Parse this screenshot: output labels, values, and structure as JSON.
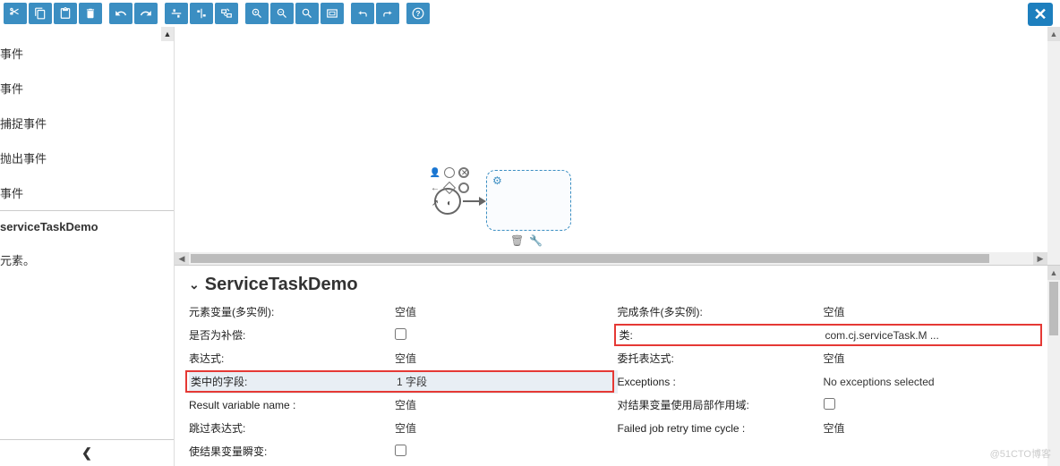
{
  "toolbar": {
    "groups": [
      [
        "cut",
        "copy",
        "paste",
        "delete"
      ],
      [
        "undo",
        "redo"
      ],
      [
        "align-h",
        "align-v",
        "same-size"
      ],
      [
        "zoom-in",
        "zoom-out",
        "zoom-fit",
        "zoom-actual"
      ],
      [
        "bend-left",
        "bend-right"
      ],
      [
        "help"
      ]
    ]
  },
  "sidebar": {
    "items": [
      {
        "label": "事件"
      },
      {
        "label": "事件"
      },
      {
        "label": "捕捉事件"
      },
      {
        "label": "抛出事件"
      },
      {
        "label": "事件"
      },
      {
        "label": ""
      },
      {
        "label": "serviceTaskDemo",
        "selected": true
      },
      {
        "label": "元素。"
      }
    ]
  },
  "properties": {
    "title": "ServiceTaskDemo",
    "left_rows": [
      {
        "label": "元素变量(多实例):",
        "value": "空值"
      },
      {
        "label": "是否为补偿:",
        "value": "",
        "checkbox": true
      },
      {
        "label": "表达式:",
        "value": "空值"
      },
      {
        "label": "类中的字段:",
        "value": "1 字段",
        "highlighted": true,
        "redbox": true
      },
      {
        "label": "Result variable name :",
        "value": "空值"
      },
      {
        "label": "跳过表达式:",
        "value": "空值"
      },
      {
        "label": "使结果变量瞬变:",
        "value": "",
        "checkbox": true
      }
    ],
    "right_rows": [
      {
        "label": "完成条件(多实例):",
        "value": "空值"
      },
      {
        "label": "类:",
        "value": "com.cj.serviceTask.M ...",
        "redbox": true
      },
      {
        "label": "委托表达式:",
        "value": "空值"
      },
      {
        "label": "Exceptions :",
        "value": "No exceptions selected"
      },
      {
        "label": "对结果变量使用局部作用域:",
        "value": "",
        "checkbox": true
      },
      {
        "label": "Failed job retry time cycle :",
        "value": "空值"
      }
    ]
  },
  "watermark": "@51CTO博客"
}
